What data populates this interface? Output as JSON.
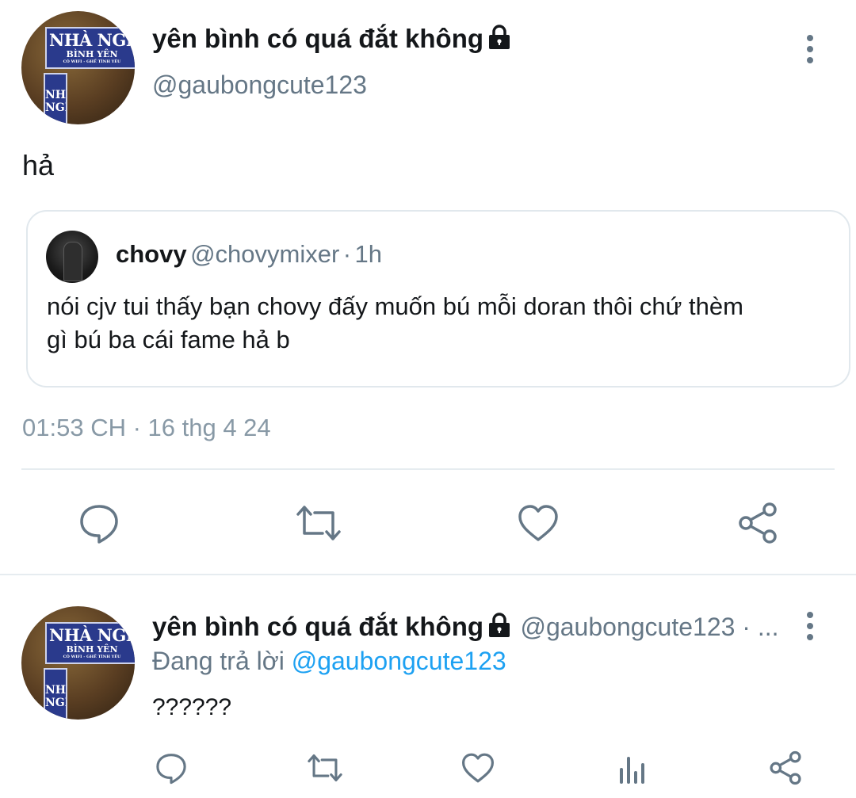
{
  "main_tweet": {
    "display_name": "yên bình có quá đắt không",
    "handle": "@gaubongcute123",
    "text": "hả",
    "avatar_sign": {
      "line1": "NHÀ NGHỈ",
      "line2": "BÌNH YÊN",
      "line3": "CÓ WIFI - GHẾ TÌNH YÊU",
      "side": "NHÀ NGHỈ"
    },
    "quote": {
      "display_name": "chovy",
      "handle": "@chovymixer",
      "separator": "·",
      "time": "1h",
      "text": "nói cjv tui thấy bạn chovy đấy muốn bú mỗi doran thôi chứ thèm gì bú ba cái fame hả b"
    },
    "timestamp": "01:53 CH · 16 thg 4 24",
    "actions": [
      "reply-icon",
      "retweet-icon",
      "like-icon",
      "share-icon"
    ]
  },
  "reply_tweet": {
    "display_name": "yên bình có quá đắt không",
    "handle_meta": "@gaubongcute123 · ...",
    "replying_prefix": "Đang trả lời",
    "replying_to": "@gaubongcute123",
    "text": "??????",
    "avatar_sign": {
      "line1": "NHÀ NGHỈ",
      "line2": "BÌNH YÊN",
      "line3": "CÓ WIFI - GHẾ TÌNH YÊU",
      "side": "NHÀ NGHỈ"
    },
    "actions": [
      "reply-icon",
      "retweet-icon",
      "like-icon",
      "analytics-icon",
      "share-icon"
    ]
  },
  "colors": {
    "text": "#14171a",
    "secondary": "#657786",
    "link": "#1da1f2",
    "divider": "#e6ecf0"
  }
}
